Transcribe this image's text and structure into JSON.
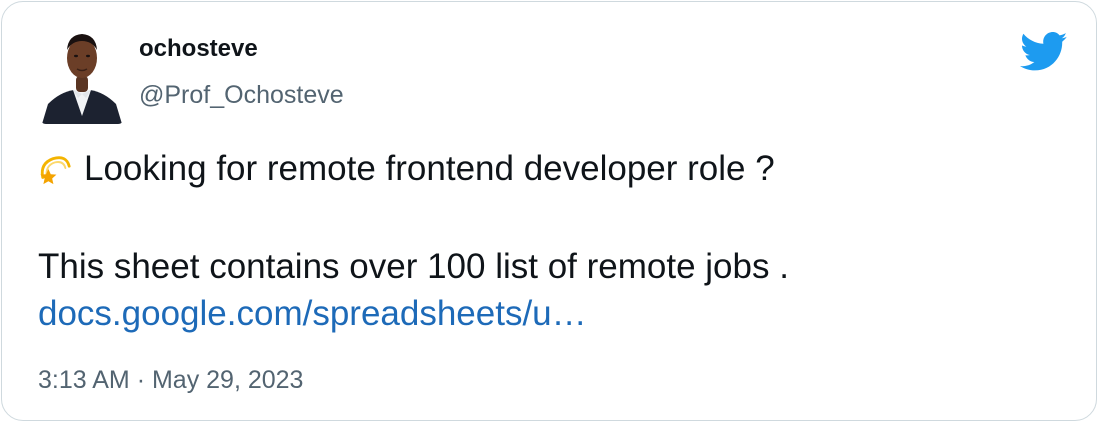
{
  "user": {
    "display_name": "ochosteve",
    "handle": "@Prof_Ochosteve"
  },
  "tweet": {
    "emoji": "dizzy-star",
    "line1": "Looking for remote frontend developer role ?",
    "line2": "This sheet contains over 100 list of remote jobs .",
    "link": "docs.google.com/spreadsheets/u…"
  },
  "meta": {
    "time": "3:13 AM",
    "separator": "·",
    "date": "May 29, 2023"
  },
  "colors": {
    "text": "#0f1419",
    "secondary": "#536471",
    "link": "#1d6ab8",
    "twitter_blue": "#1d9bf0",
    "border": "#cfd9de"
  },
  "icons": {
    "brand": "twitter-bird-icon"
  }
}
